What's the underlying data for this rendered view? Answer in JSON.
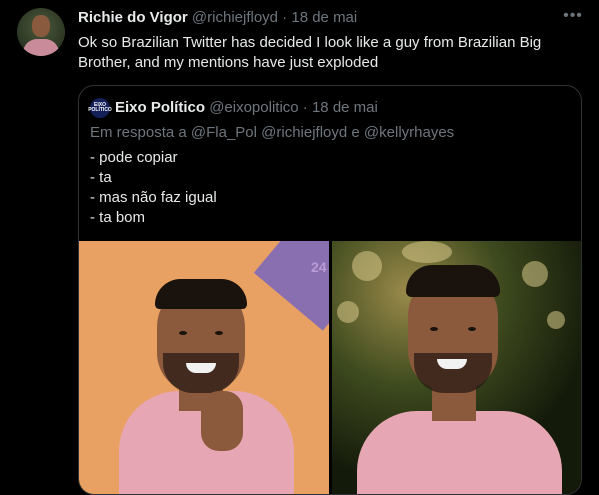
{
  "tweet": {
    "author_name": "Richie do Vigor",
    "author_handle": "@richiejfloyd",
    "separator": "·",
    "date": "18 de mai",
    "more_icon": "more-horizontal-icon",
    "text": "Ok so Brazilian Twitter has decided I look like a guy from Brazilian Big Brother, and my mentions have just exploded"
  },
  "quote": {
    "avatar_label": "EIXO POLÍTICO",
    "author_name": "Eixo Político",
    "author_handle": "@eixopolitico",
    "separator": "·",
    "date": "18 de mai",
    "reply_prefix": "Em resposta a",
    "reply_mentions": "@Fla_Pol @richiejfloyd e @kellyrhayes",
    "lines": [
      "- pode copiar",
      "- ta",
      "- mas não faz igual",
      "- ta bom"
    ],
    "panel_text": "24"
  },
  "colors": {
    "background": "#000000",
    "text_primary": "#e7e9ea",
    "text_secondary": "#6e767d",
    "border": "#2f3336"
  }
}
